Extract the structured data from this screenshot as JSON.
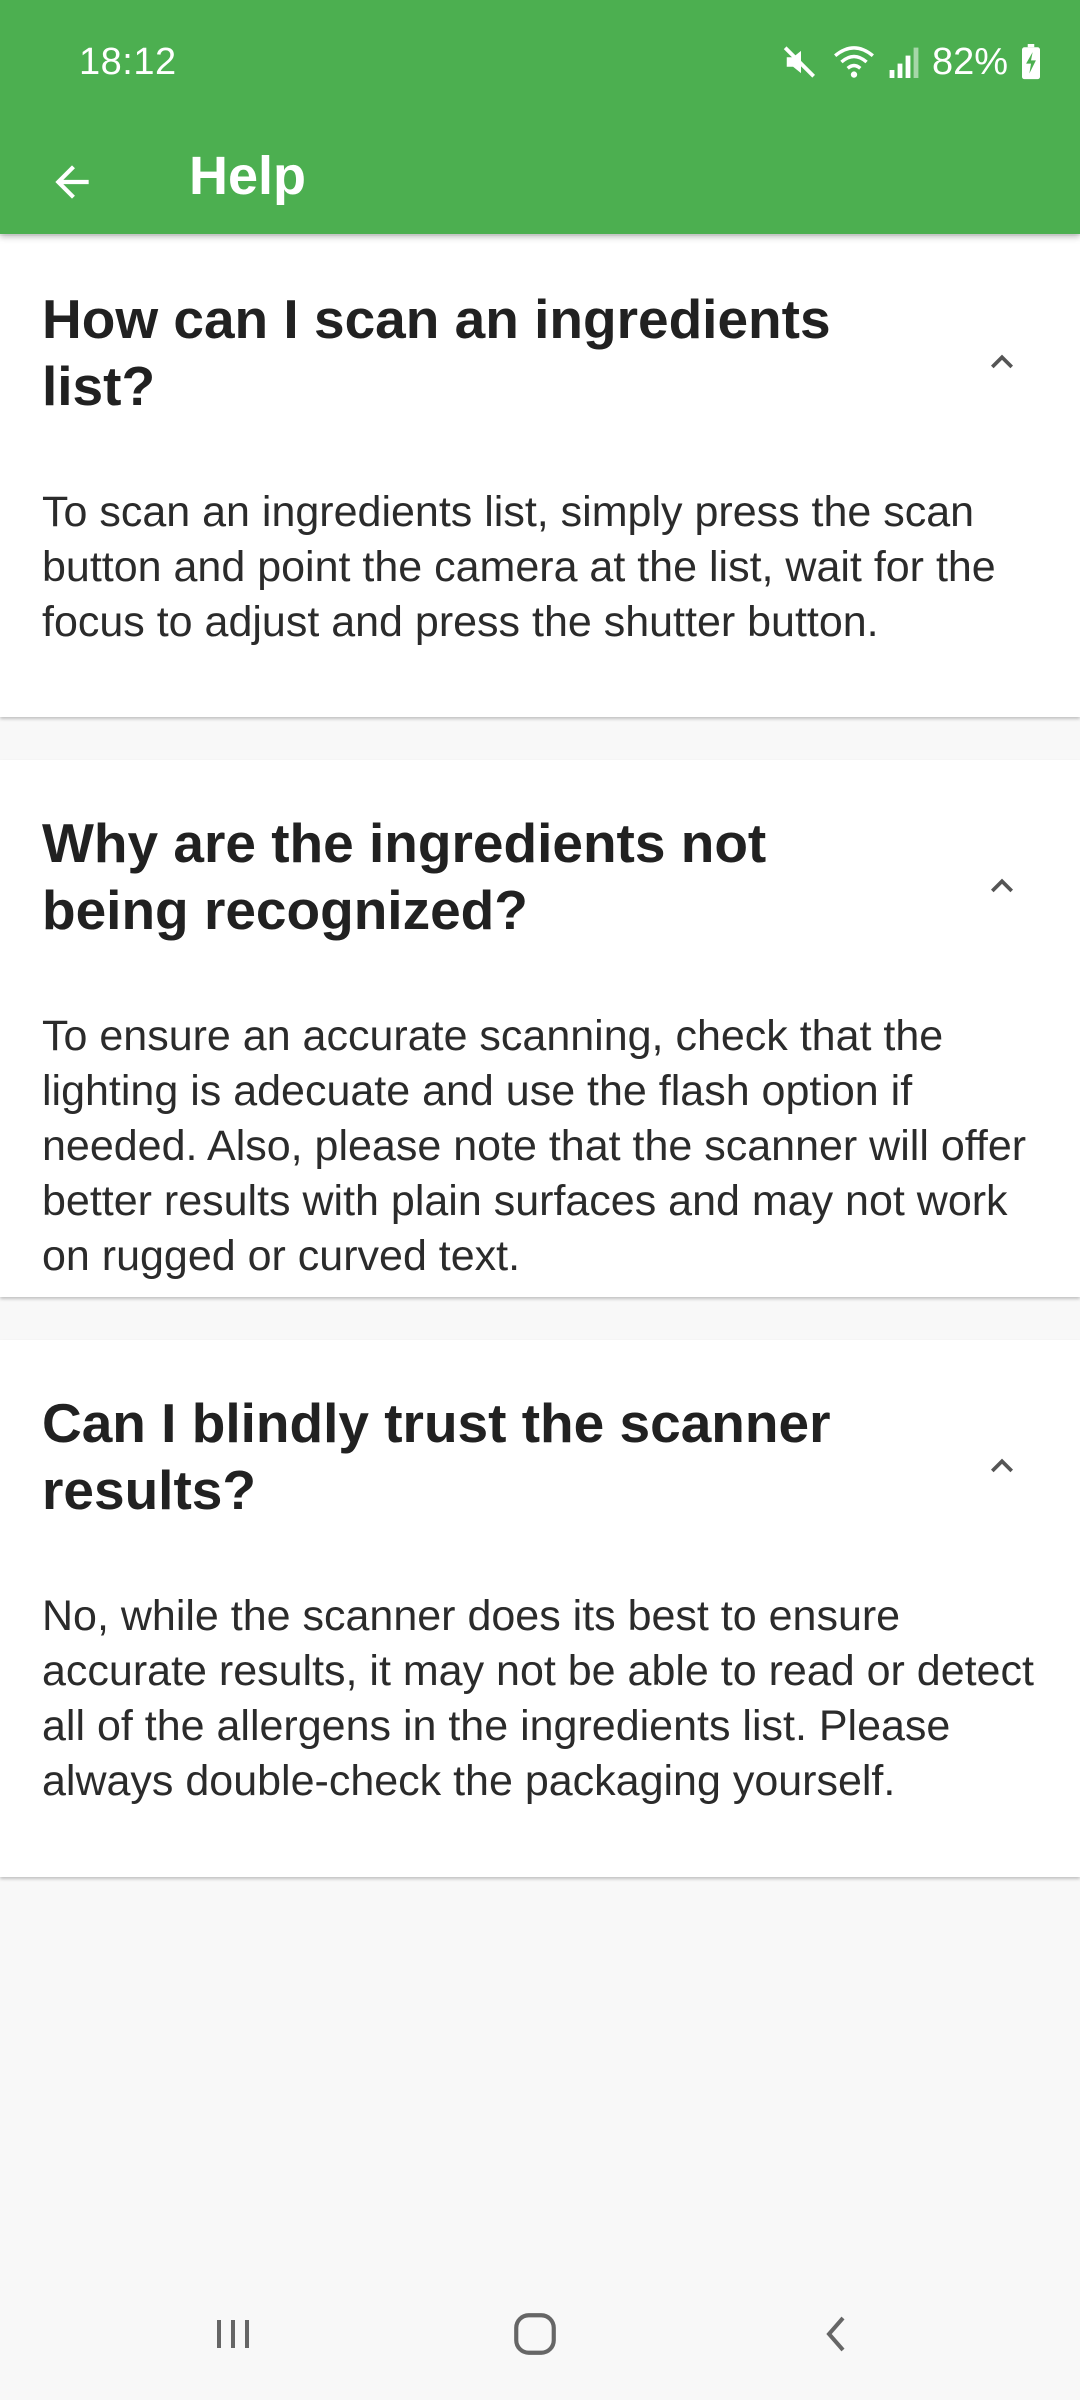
{
  "status_bar": {
    "time": "18:12",
    "battery_percent": "82%",
    "icons": [
      "mute-icon",
      "wifi-icon",
      "signal-icon",
      "battery-charging-icon"
    ]
  },
  "toolbar": {
    "title": "Help",
    "back_icon": "arrow-left-icon"
  },
  "faq": [
    {
      "question": "How can I scan an ingredients list?",
      "answer": "To scan an ingredients list, simply press the scan button and point the camera at the list, wait for the focus to adjust and press the shutter button.",
      "expanded": true
    },
    {
      "question": "Why are the ingredients not being recognized?",
      "answer": "To ensure an accurate scanning, check that the lighting is adecuate and use the flash option if needed. Also, please note that the scanner will offer better results with plain surfaces and may not work on rugged or curved text.",
      "expanded": true
    },
    {
      "question": "Can I blindly trust the scanner results?",
      "answer": "No, while the scanner does its best to ensure accurate results, it may not be able to read or detect all of the allergens in the ingredients list. Please always double-check the packaging yourself.",
      "expanded": true
    }
  ],
  "nav_bar": {
    "icons": [
      "recent-apps-icon",
      "home-icon",
      "back-icon"
    ]
  },
  "colors": {
    "primary": "#4caf50",
    "background": "#f8f8f8",
    "card": "#ffffff",
    "text": "#212121"
  }
}
